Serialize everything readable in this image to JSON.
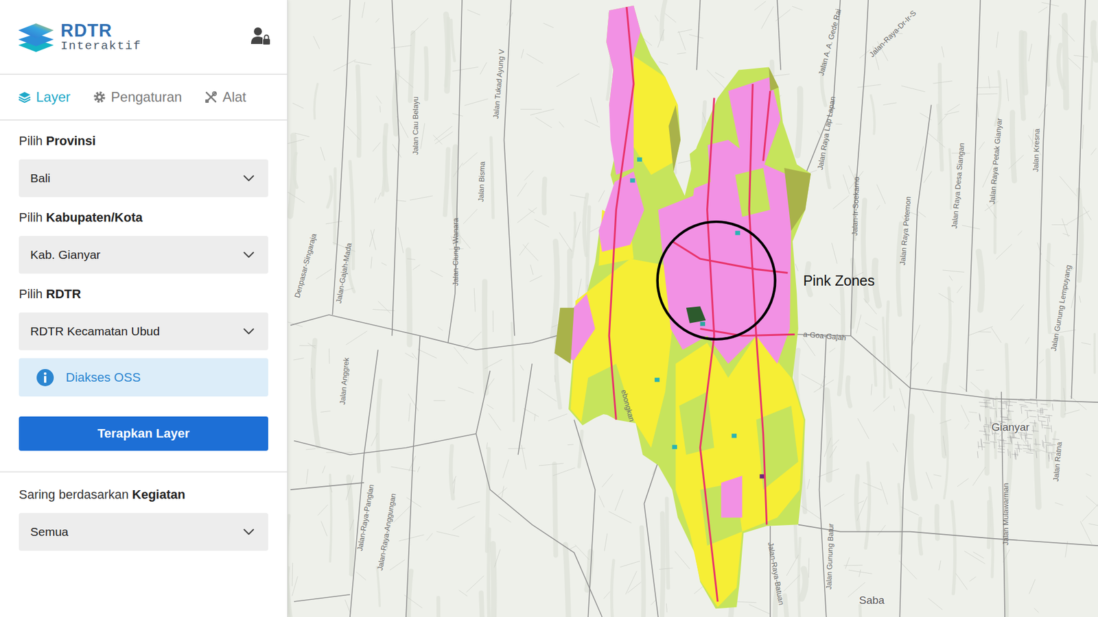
{
  "app": {
    "logo_title": "RDTR",
    "logo_subtitle": "Interaktif"
  },
  "tabs": [
    {
      "label": "Layer",
      "selected": true
    },
    {
      "label": "Pengaturan",
      "selected": false
    },
    {
      "label": "Alat",
      "selected": false
    }
  ],
  "fields": [
    {
      "label_prefix": "Pilih",
      "label_bold": "Provinsi",
      "value": "Bali"
    },
    {
      "label_prefix": "Pilih",
      "label_bold": "Kabupaten/Kota",
      "value": "Kab. Gianyar"
    },
    {
      "label_prefix": "Pilih",
      "label_bold": "RDTR",
      "value": "RDTR Kecamatan Ubud"
    }
  ],
  "info": {
    "text": "Diakses OSS"
  },
  "apply_button": "Terapkan Layer",
  "filter": {
    "label_prefix": "Saring berdasarkan",
    "label_bold": "Kegiatan",
    "value": "Semua"
  },
  "map": {
    "road_labels": [
      "Jalan Cau Belayu",
      "Jalan Tukad Ayung V",
      "Jalan Bisma",
      "Jalan-Ciung-Wanara",
      "Denpasar-Singaraja",
      "Jalan-Gajah-Mada",
      "Jalan Anggrek",
      "Jalan-Raya-Panglan",
      "Jalan-Raya-Anggungan",
      "Jalan Raya Lap Lapan",
      "Jalan-Ir-Soekarno",
      "Jalan Raya Petemon",
      "Jalan Raya Desa Siangan",
      "Jalan Raya Petak Gianyar",
      "Jalan Kresna",
      "Jalan Gunung Lempuyang",
      "Jalan Gunung Batur",
      "Jalan-Raya-Batuan",
      "Jalan Mulawarman",
      "Jalan Ratna",
      "Jalan A. A. Gede Rai",
      "Jalan-Raya-Dr-Ir-S",
      "a-Goa-Gajah",
      "ebongkan"
    ],
    "place_labels": [
      "Gianyar",
      "Saba"
    ],
    "annotation": "Pink Zones"
  }
}
